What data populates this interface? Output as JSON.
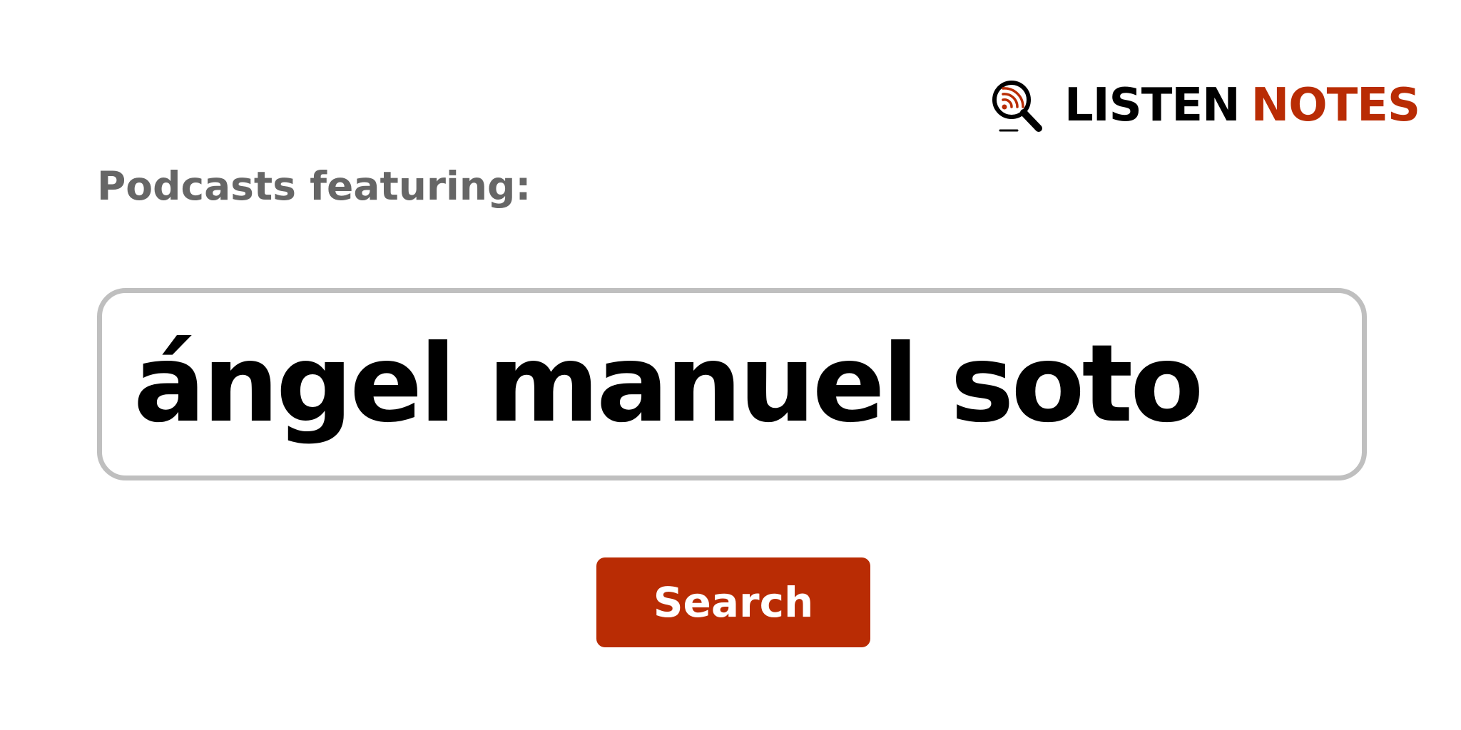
{
  "logo": {
    "word1": "LISTEN",
    "word2": "NOTES",
    "icon": "magnifier-rss-icon",
    "color_primary": "#000000",
    "color_accent": "#b92c04"
  },
  "heading": "Podcasts featuring:",
  "search": {
    "value": "ángel manuel soto",
    "placeholder": ""
  },
  "button": {
    "label": "Search",
    "color": "#b92c04"
  }
}
